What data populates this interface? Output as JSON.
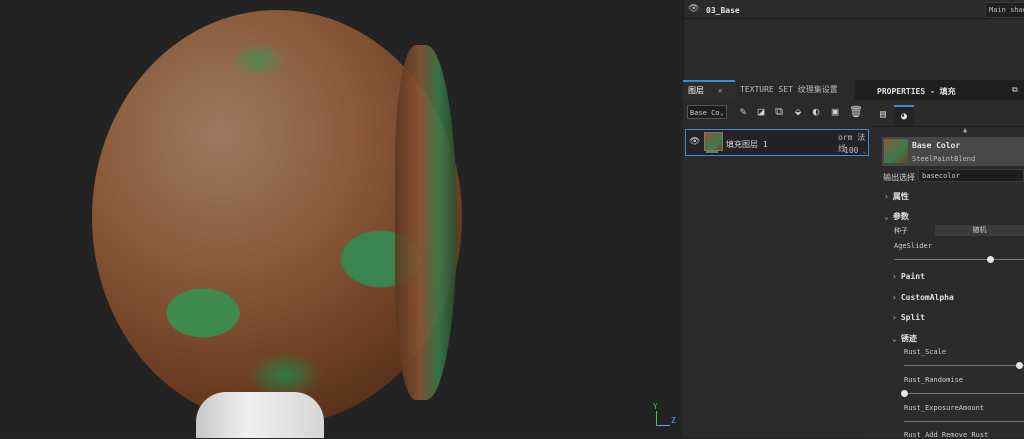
{
  "viewport": {
    "axis_y": "Y",
    "axis_z": "Z"
  },
  "topbar": {
    "title": "03_Base",
    "shader_label": "Main shader"
  },
  "layers_panel": {
    "tab_layers": "图层",
    "tab_texture_set": "TEXTURE SET 纹理集设置",
    "channel_select": "Base Co",
    "layer": {
      "name": "填充图层 1",
      "blend": "orm 法线",
      "opacity": "100"
    }
  },
  "properties": {
    "title": "PROPERTIES - 填充",
    "material_name": "Base Color",
    "material_sub": "SteelPaintBlend",
    "output_label": "输出选择",
    "output_value": "basecolor",
    "sections": {
      "attributes": "属性",
      "params": "参数",
      "seed_label": "种子",
      "seed_button": "随机",
      "age_slider": "AgeSlider",
      "paint": "Paint",
      "custom_alpha": "CustomAlpha",
      "split": "Split",
      "rust": "锈迹",
      "rust_scale": "Rust_Scale",
      "rust_randomise": "Rust_Randomise",
      "rust_exposure": "Rust_ExposureAmount",
      "rust_add_remove": "Rust Add Remove Rust"
    },
    "slider_values": {
      "age_slider": 0.74,
      "rust_scale": 0.74,
      "rust_randomise": 0.0
    }
  }
}
